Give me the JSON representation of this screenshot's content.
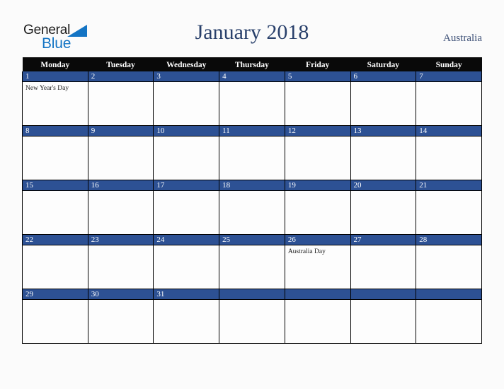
{
  "logo": {
    "word_one": "General",
    "word_two": "Blue",
    "triangle_icon": "blue-triangle-flag-icon",
    "word_one_color": "#1b1b1b",
    "word_two_color": "#1374c4"
  },
  "header": {
    "title": "January 2018",
    "country": "Australia",
    "title_color": "#29406b",
    "country_color": "#3f5278"
  },
  "colors": {
    "page_background": "#fbfbfb",
    "weekday_header_background": "#090909",
    "weekday_header_text": "#ffffff",
    "date_band_background": "#2d5194",
    "date_band_text": "#ffffff",
    "cell_background": "#fdfdfd",
    "grid_line": "#000000"
  },
  "calendar": {
    "month": "January",
    "year": "2018",
    "weekday_headers": [
      "Monday",
      "Tuesday",
      "Wednesday",
      "Thursday",
      "Friday",
      "Saturday",
      "Sunday"
    ],
    "weeks": [
      [
        {
          "day": "1",
          "event": "New Year's Day"
        },
        {
          "day": "2",
          "event": ""
        },
        {
          "day": "3",
          "event": ""
        },
        {
          "day": "4",
          "event": ""
        },
        {
          "day": "5",
          "event": ""
        },
        {
          "day": "6",
          "event": ""
        },
        {
          "day": "7",
          "event": ""
        }
      ],
      [
        {
          "day": "8",
          "event": ""
        },
        {
          "day": "9",
          "event": ""
        },
        {
          "day": "10",
          "event": ""
        },
        {
          "day": "11",
          "event": ""
        },
        {
          "day": "12",
          "event": ""
        },
        {
          "day": "13",
          "event": ""
        },
        {
          "day": "14",
          "event": ""
        }
      ],
      [
        {
          "day": "15",
          "event": ""
        },
        {
          "day": "16",
          "event": ""
        },
        {
          "day": "17",
          "event": ""
        },
        {
          "day": "18",
          "event": ""
        },
        {
          "day": "19",
          "event": ""
        },
        {
          "day": "20",
          "event": ""
        },
        {
          "day": "21",
          "event": ""
        }
      ],
      [
        {
          "day": "22",
          "event": ""
        },
        {
          "day": "23",
          "event": ""
        },
        {
          "day": "24",
          "event": ""
        },
        {
          "day": "25",
          "event": ""
        },
        {
          "day": "26",
          "event": "Australia Day"
        },
        {
          "day": "27",
          "event": ""
        },
        {
          "day": "28",
          "event": ""
        }
      ],
      [
        {
          "day": "29",
          "event": ""
        },
        {
          "day": "30",
          "event": ""
        },
        {
          "day": "31",
          "event": ""
        },
        {
          "day": "",
          "event": ""
        },
        {
          "day": "",
          "event": ""
        },
        {
          "day": "",
          "event": ""
        },
        {
          "day": "",
          "event": ""
        }
      ]
    ]
  }
}
